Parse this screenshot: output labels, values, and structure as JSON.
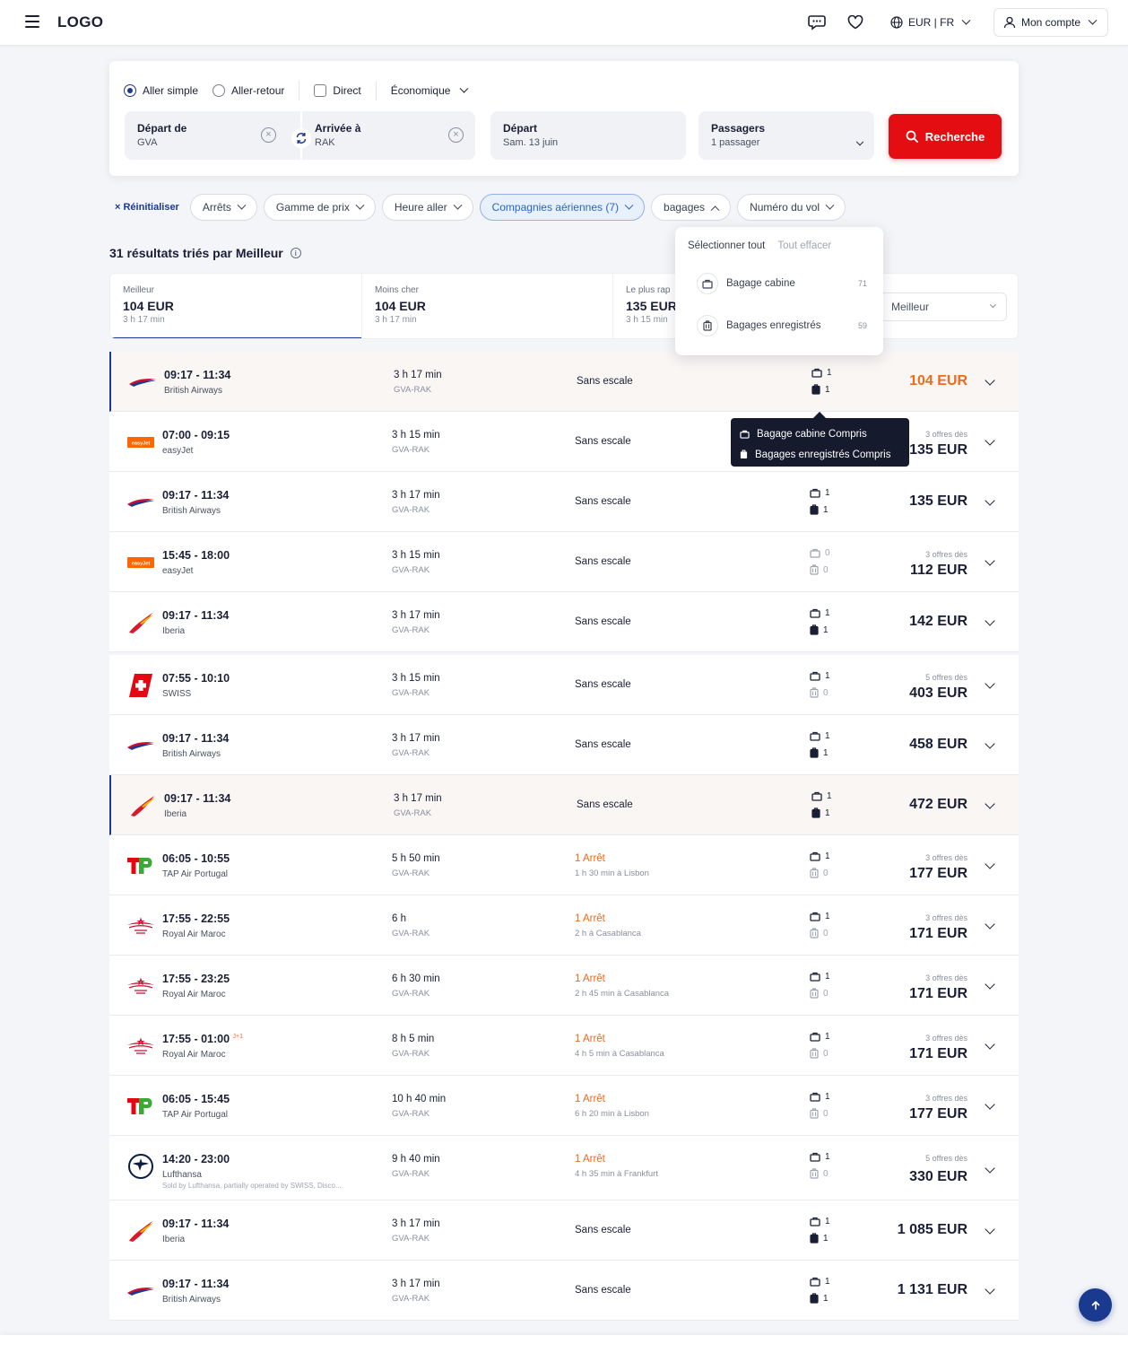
{
  "header": {
    "logo": "LOGO",
    "currency_lang": "EUR | FR",
    "account": "Mon compte"
  },
  "search": {
    "trip_one_way": "Aller simple",
    "trip_round": "Aller-retour",
    "direct": "Direct",
    "cabin": "Économique",
    "from_label": "Départ de",
    "from_value": "GVA",
    "to_label": "Arrivée à",
    "to_value": "RAK",
    "date_label": "Départ",
    "date_value": "Sam. 13 juin",
    "pax_label": "Passagers",
    "pax_value": "1 passager",
    "search_button": "Recherche"
  },
  "filters": {
    "reset": "× Réinitialiser",
    "chips": [
      {
        "label": "Arrêts"
      },
      {
        "label": "Gamme de prix"
      },
      {
        "label": "Heure aller"
      },
      {
        "label": "Compagnies aériennes (7)"
      },
      {
        "label": "bagages"
      },
      {
        "label": "Numéro du vol"
      }
    ]
  },
  "results_title": "31 résultats triés par Meilleur",
  "sort_tabs": [
    {
      "label": "Meilleur",
      "price": "104 EUR",
      "duration": "3 h 17 min"
    },
    {
      "label": "Moins cher",
      "price": "104 EUR",
      "duration": "3 h 17 min"
    },
    {
      "label": "Le plus rap",
      "price": "135 EUR",
      "duration": "3 h 15 min"
    }
  ],
  "sort_select": "Meilleur",
  "bag_dropdown": {
    "select_all": "Sélectionner tout",
    "clear_all": "Tout effacer",
    "items": [
      {
        "label": "Bagage cabine",
        "count": "71"
      },
      {
        "label": "Bagages enregistrés",
        "count": "59"
      }
    ]
  },
  "tooltip": {
    "line1": "Bagage cabine Compris",
    "line2": "Bagages enregistrés Compris"
  },
  "flights": [
    {
      "logo": "ba",
      "times": "09:17 - 11:34",
      "next_day": "",
      "airline": "British Airways",
      "note": "",
      "duration": "3 h 17 min",
      "route": "GVA-RAK",
      "stops": "Sans escale",
      "stop_detail": "",
      "cabin": "1",
      "checked": "1",
      "offers": "",
      "price": "104 EUR"
    },
    {
      "logo": "ej",
      "times": "07:00 - 09:15",
      "next_day": "",
      "airline": "easyJet",
      "note": "",
      "duration": "3 h 15 min",
      "route": "GVA-RAK",
      "stops": "Sans escale",
      "stop_detail": "",
      "cabin": "",
      "checked": "",
      "offers": "3 offres dès",
      "price": "135 EUR"
    },
    {
      "logo": "ba",
      "times": "09:17 - 11:34",
      "next_day": "",
      "airline": "British Airways",
      "note": "",
      "duration": "3 h 17 min",
      "route": "GVA-RAK",
      "stops": "Sans escale",
      "stop_detail": "",
      "cabin": "1",
      "checked": "1",
      "offers": "",
      "price": "135 EUR"
    },
    {
      "logo": "ej",
      "times": "15:45 - 18:00",
      "next_day": "",
      "airline": "easyJet",
      "note": "",
      "duration": "3 h 15 min",
      "route": "GVA-RAK",
      "stops": "Sans escale",
      "stop_detail": "",
      "cabin": "0",
      "checked": "0",
      "offers": "3 offres dès",
      "price": "112 EUR"
    },
    {
      "logo": "ib",
      "times": "09:17 - 11:34",
      "next_day": "",
      "airline": "Iberia",
      "note": "",
      "duration": "3 h 17 min",
      "route": "GVA-RAK",
      "stops": "Sans escale",
      "stop_detail": "",
      "cabin": "1",
      "checked": "1",
      "offers": "",
      "price": "142 EUR"
    },
    {
      "logo": "sw",
      "times": "07:55 - 10:10",
      "next_day": "",
      "airline": "SWISS",
      "note": "",
      "duration": "3 h 15 min",
      "route": "GVA-RAK",
      "stops": "Sans escale",
      "stop_detail": "",
      "cabin": "1",
      "checked": "0",
      "offers": "5 offres dès",
      "price": "403 EUR"
    },
    {
      "logo": "ba",
      "times": "09:17 - 11:34",
      "next_day": "",
      "airline": "British Airways",
      "note": "",
      "duration": "3 h 17 min",
      "route": "GVA-RAK",
      "stops": "Sans escale",
      "stop_detail": "",
      "cabin": "1",
      "checked": "1",
      "offers": "",
      "price": "458 EUR"
    },
    {
      "logo": "ib",
      "times": "09:17 - 11:34",
      "next_day": "",
      "airline": "Iberia",
      "note": "",
      "duration": "3 h 17 min",
      "route": "GVA-RAK",
      "stops": "Sans escale",
      "stop_detail": "",
      "cabin": "1",
      "checked": "1",
      "offers": "",
      "price": "472 EUR"
    },
    {
      "logo": "tp",
      "times": "06:05 - 10:55",
      "next_day": "",
      "airline": "TAP Air Portugal",
      "note": "",
      "duration": "5 h 50 min",
      "route": "GVA-RAK",
      "stops": "1 Arrêt",
      "stop_detail": "1 h 30 min à Lisbon",
      "cabin": "1",
      "checked": "0",
      "offers": "3 offres dès",
      "price": "177 EUR"
    },
    {
      "logo": "ram",
      "times": "17:55 - 22:55",
      "next_day": "",
      "airline": "Royal Air Maroc",
      "note": "",
      "duration": "6 h",
      "route": "GVA-RAK",
      "stops": "1 Arrêt",
      "stop_detail": "2 h à Casablanca",
      "cabin": "1",
      "checked": "0",
      "offers": "3 offres dès",
      "price": "171 EUR"
    },
    {
      "logo": "ram",
      "times": "17:55 - 23:25",
      "next_day": "",
      "airline": "Royal Air Maroc",
      "note": "",
      "duration": "6 h 30 min",
      "route": "GVA-RAK",
      "stops": "1 Arrêt",
      "stop_detail": "2 h 45 min à Casablanca",
      "cabin": "1",
      "checked": "0",
      "offers": "3 offres dès",
      "price": "171 EUR"
    },
    {
      "logo": "ram",
      "times": "17:55 - 01:00",
      "next_day": "J+1",
      "airline": "Royal Air Maroc",
      "note": "",
      "duration": "8 h 5 min",
      "route": "GVA-RAK",
      "stops": "1 Arrêt",
      "stop_detail": "4 h 5 min à Casablanca",
      "cabin": "1",
      "checked": "0",
      "offers": "3 offres dès",
      "price": "171 EUR"
    },
    {
      "logo": "tp",
      "times": "06:05 - 15:45",
      "next_day": "",
      "airline": "TAP Air Portugal",
      "note": "",
      "duration": "10 h 40 min",
      "route": "GVA-RAK",
      "stops": "1 Arrêt",
      "stop_detail": "6 h 20 min à Lisbon",
      "cabin": "1",
      "checked": "0",
      "offers": "3 offres dès",
      "price": "177 EUR"
    },
    {
      "logo": "lh",
      "times": "14:20 - 23:00",
      "next_day": "",
      "airline": "Lufthansa",
      "note": "Sold by Lufthansa, partially operated by SWISS, Disco...",
      "duration": "9 h 40 min",
      "route": "GVA-RAK",
      "stops": "1 Arrêt",
      "stop_detail": "4 h 35 min à Frankfurt",
      "cabin": "1",
      "checked": "0",
      "offers": "5 offres dès",
      "price": "330 EUR"
    },
    {
      "logo": "ib",
      "times": "09:17 - 11:34",
      "next_day": "",
      "airline": "Iberia",
      "note": "",
      "duration": "3 h 17 min",
      "route": "GVA-RAK",
      "stops": "Sans escale",
      "stop_detail": "",
      "cabin": "1",
      "checked": "1",
      "offers": "",
      "price": "1 085 EUR"
    },
    {
      "logo": "ba",
      "times": "09:17 - 11:34",
      "next_day": "",
      "airline": "British Airways",
      "note": "",
      "duration": "3 h 17 min",
      "route": "GVA-RAK",
      "stops": "Sans escale",
      "stop_detail": "",
      "cabin": "1",
      "checked": "1",
      "offers": "",
      "price": "1 131 EUR"
    }
  ],
  "colors": {
    "accent": "#1a3a8f",
    "search_red": "#e30d12",
    "stop_orange": "#e86a1e",
    "best_price": "#f06a1a"
  }
}
